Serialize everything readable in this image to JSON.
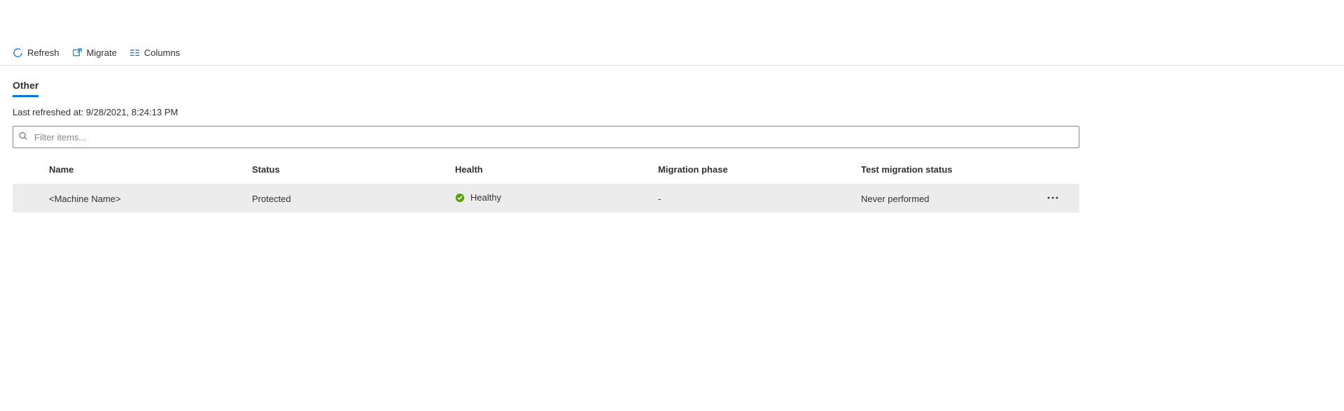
{
  "toolbar": {
    "refresh_label": "Refresh",
    "migrate_label": "Migrate",
    "columns_label": "Columns"
  },
  "tabs": {
    "active": "Other"
  },
  "status": {
    "refreshed_prefix": "Last refreshed at: ",
    "refreshed_time": "9/28/2021, 8:24:13 PM"
  },
  "filter": {
    "placeholder": "Filter items..."
  },
  "columns": {
    "name": "Name",
    "status": "Status",
    "health": "Health",
    "migration_phase": "Migration phase",
    "test_migration_status": "Test migration status"
  },
  "rows": [
    {
      "name": "<Machine Name>",
      "status": "Protected",
      "health": "Healthy",
      "health_color": "#57a300",
      "migration_phase": "-",
      "test_migration_status": "Never performed"
    }
  ]
}
